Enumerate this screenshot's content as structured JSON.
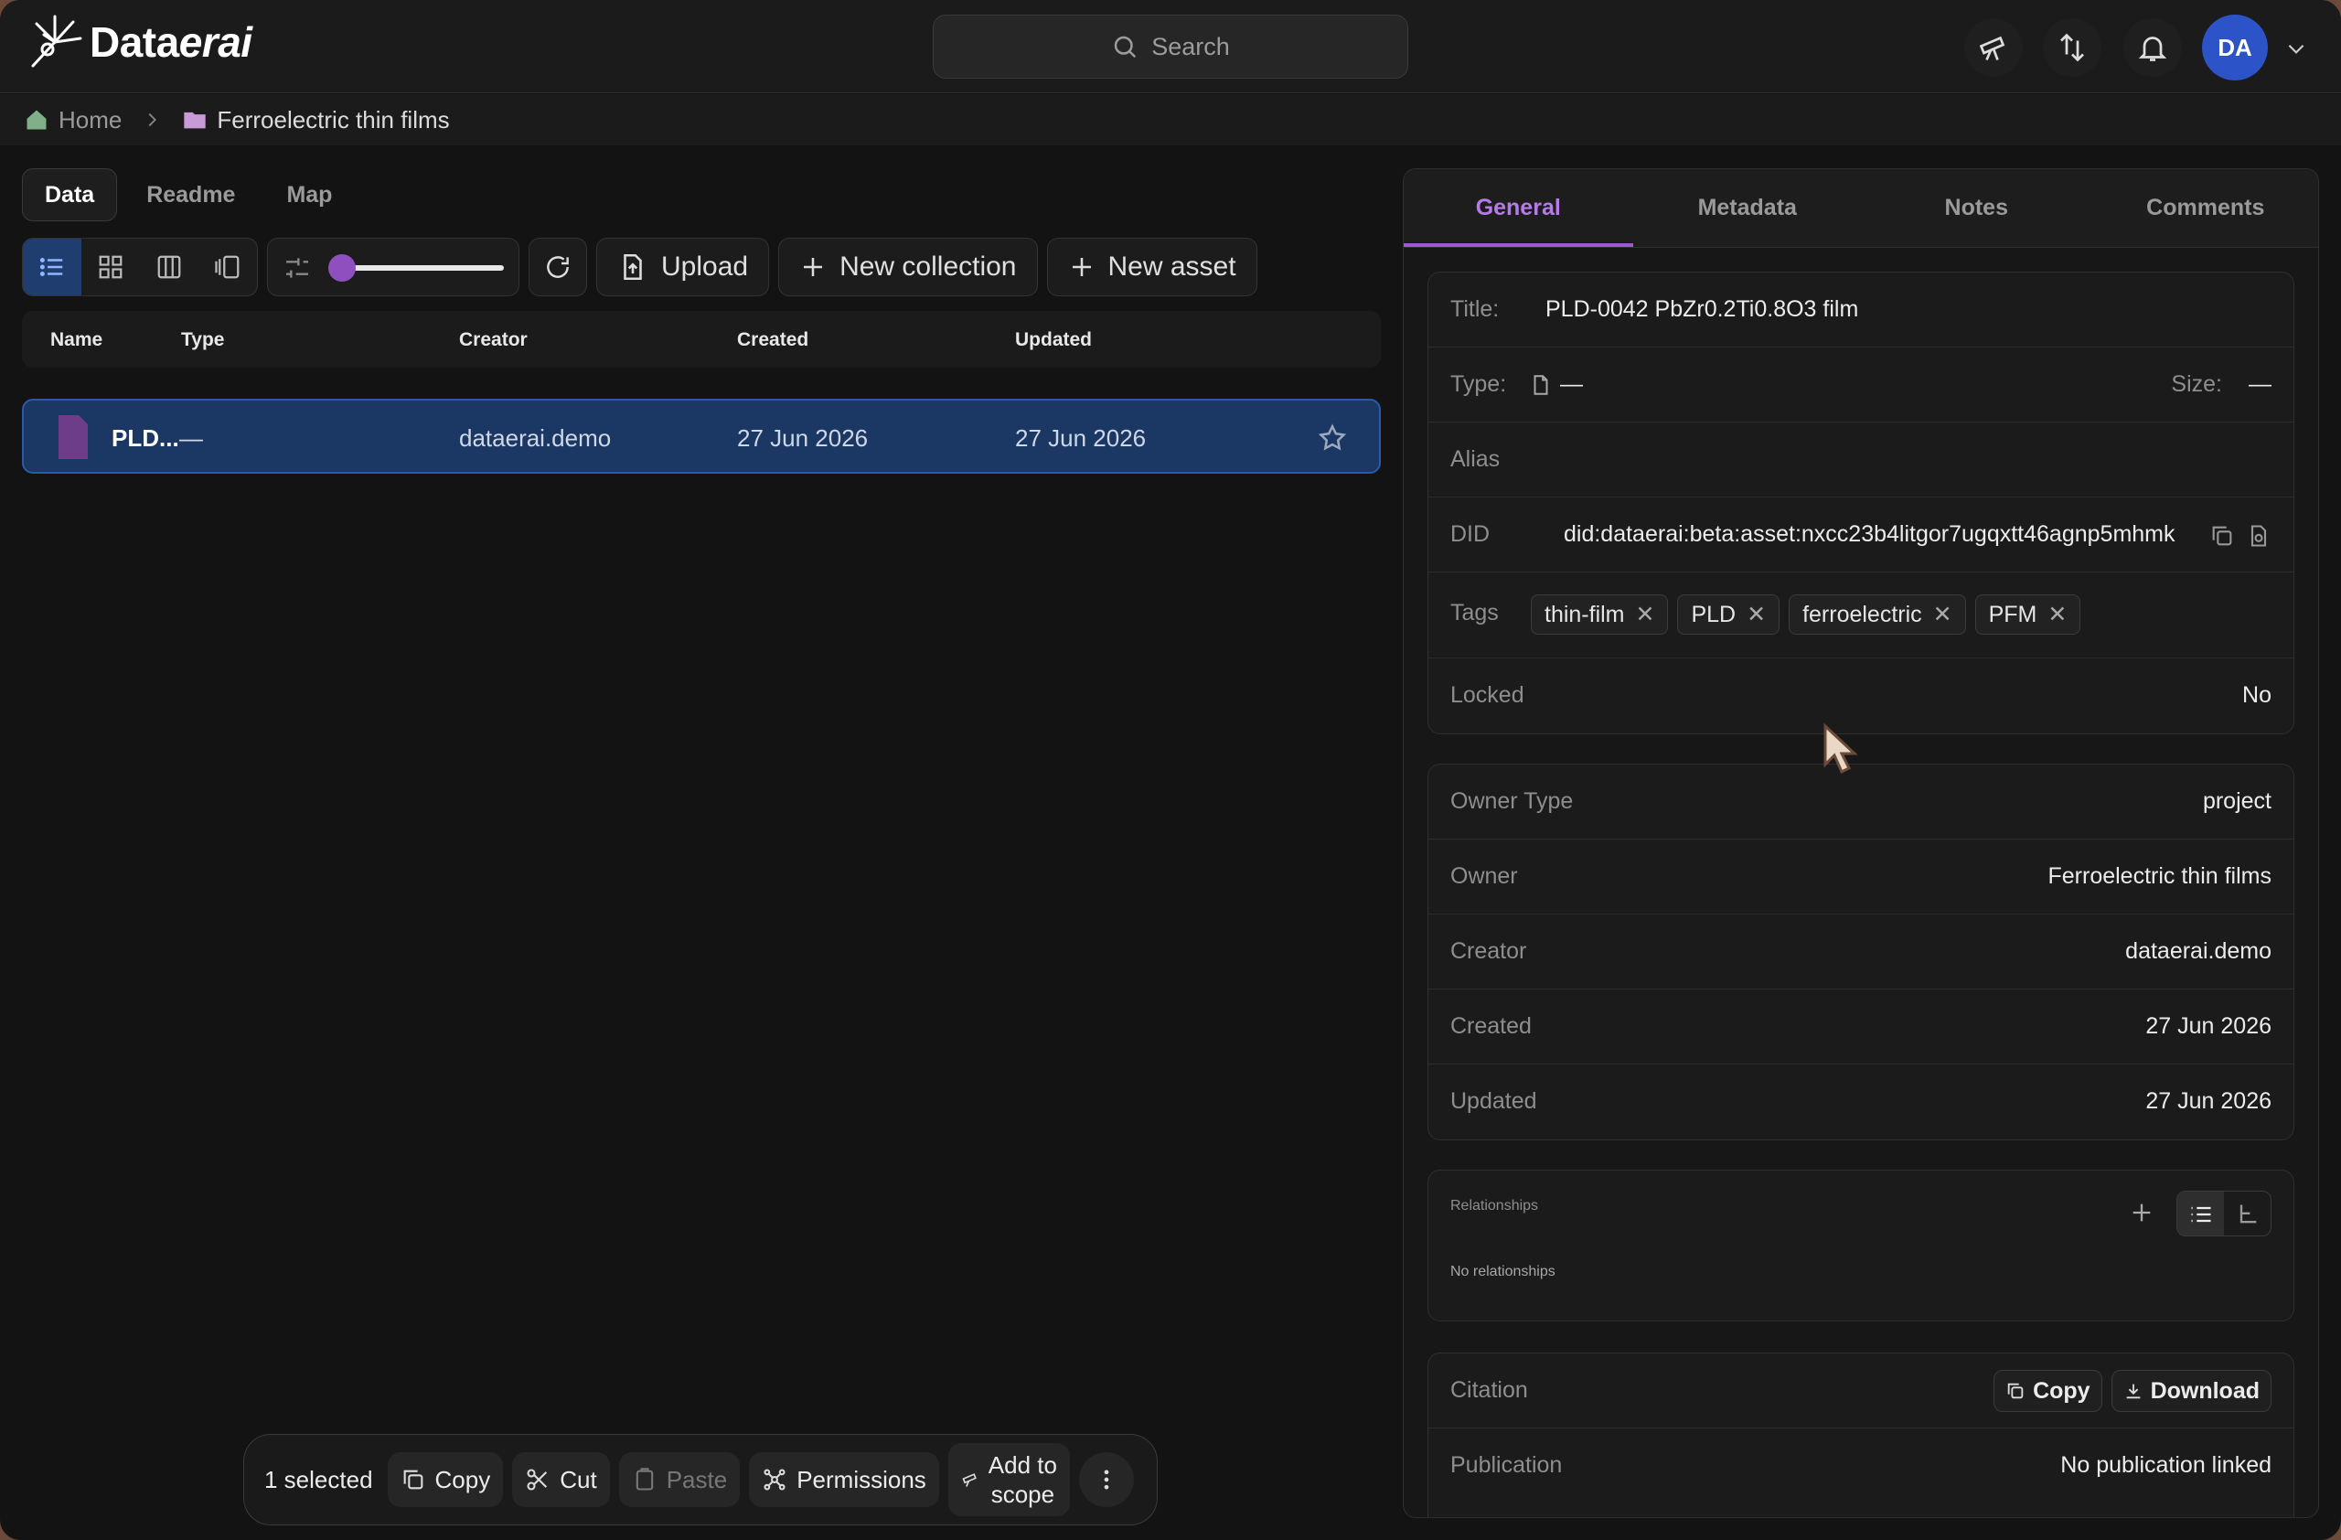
{
  "app": {
    "brand_prefix": "Data",
    "brand_suffix": "erai",
    "search_placeholder": "Search",
    "avatar_initials": "DA"
  },
  "breadcrumb": {
    "home": "Home",
    "current": "Ferroelectric thin films"
  },
  "left_tabs": [
    "Data",
    "Readme",
    "Map"
  ],
  "toolbar": {
    "upload": "Upload",
    "new_collection": "New collection",
    "new_asset": "New asset",
    "zoom_fraction": 0.0
  },
  "table": {
    "columns": [
      "Name",
      "Type",
      "Creator",
      "Created",
      "Updated"
    ],
    "rows": [
      {
        "name": "PLD...",
        "type": "—",
        "creator": "dataerai.demo",
        "created": "27 Jun 2026",
        "updated": "27 Jun 2026"
      }
    ]
  },
  "selection_bar": {
    "count": "1 selected",
    "copy": "Copy",
    "cut": "Cut",
    "paste": "Paste",
    "permissions": "Permissions",
    "add_scope_1": "Add to",
    "add_scope_2": "scope"
  },
  "panel": {
    "tabs": [
      "General",
      "Metadata",
      "Notes",
      "Comments"
    ],
    "title_label": "Title:",
    "title_value": "PLD-0042 PbZr0.2Ti0.8O3 film",
    "type_label": "Type:",
    "type_value": "—",
    "size_label": "Size:",
    "size_value": "—",
    "alias_label": "Alias",
    "did_label": "DID",
    "did_value": "did:dataerai:beta:asset:nxcc23b4litgor7ugqxtt46agnp5mhmk",
    "tags_label": "Tags",
    "tags": [
      "thin-film",
      "PLD",
      "ferroelectric",
      "PFM"
    ],
    "locked_label": "Locked",
    "locked_value": "No",
    "owner_type_label": "Owner Type",
    "owner_type_value": "project",
    "owner_label": "Owner",
    "owner_value": "Ferroelectric thin films",
    "creator_label": "Creator",
    "creator_value": "dataerai.demo",
    "created_label": "Created",
    "created_value": "27 Jun 2026",
    "updated_label": "Updated",
    "updated_value": "27 Jun 2026",
    "relationships_label": "Relationships",
    "relationships_empty": "No relationships",
    "citation_label": "Citation",
    "citation_copy": "Copy",
    "citation_download": "Download",
    "publication_label": "Publication",
    "publication_value": "No publication linked"
  },
  "colors": {
    "accent": "#9b59d6",
    "selected_row": "#1b3763",
    "avatar": "#2d53c8"
  }
}
